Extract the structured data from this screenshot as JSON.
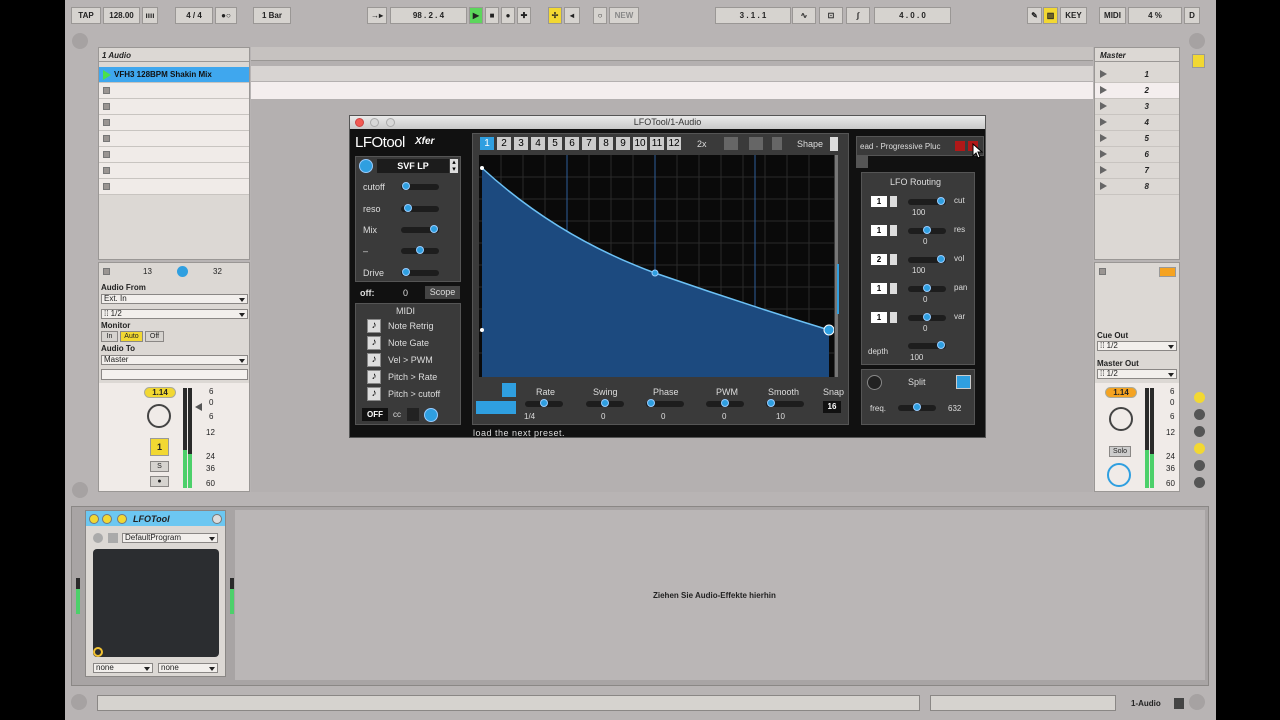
{
  "transport": {
    "tap": "TAP",
    "tempo": "128.00",
    "meter_glyph": "ıııı",
    "signature": "4 / 4",
    "metronome": "●○",
    "quantize": "1 Bar",
    "follow": "→▸",
    "position": "98 .   2 .   4",
    "new": "NEW",
    "loop_start": "3 .   1 .   1",
    "loop_len": "4 .   0 .   0",
    "key": "KEY",
    "midi": "MIDI",
    "cpu": "4 %",
    "disk": "D"
  },
  "track": {
    "name": "1 Audio",
    "clip": "VFH3 128BPM Shakin Mix",
    "seq_a": "13",
    "seq_b": "32",
    "audio_from_label": "Audio From",
    "audio_from": "Ext. In",
    "channel": "⁞⁞ 1/2",
    "monitor_label": "Monitor",
    "monitor_in": "In",
    "monitor_auto": "Auto",
    "monitor_off": "Off",
    "audio_to_label": "Audio To",
    "audio_to": "Master",
    "vol_display": "1.14",
    "meter_scale": [
      "6",
      "0",
      "6",
      "12",
      "24",
      "36",
      "60"
    ],
    "track_num": "1",
    "solo": "S",
    "arm": "●"
  },
  "master": {
    "name": "Master",
    "scenes": [
      "1",
      "2",
      "3",
      "4",
      "5",
      "6",
      "7",
      "8"
    ],
    "cue_out_label": "Cue Out",
    "cue_out": "⁞⁞ 1/2",
    "master_out_label": "Master Out",
    "master_out": "⁞⁞ 1/2",
    "vol_display": "1.14",
    "solo": "Solo",
    "meter_scale": [
      "6",
      "0",
      "6",
      "12",
      "24",
      "36",
      "60"
    ]
  },
  "device": {
    "name": "LFOTool",
    "program": "DefaultProgram",
    "sel_a": "none",
    "sel_b": "none",
    "drop_hint": "Ziehen Sie Audio-Effekte hierhin",
    "track_label": "1-Audio"
  },
  "plugin": {
    "window_title": "LFOTool/1-Audio",
    "logo": "LFOtool",
    "brand": "Xfer",
    "filter_type": "SVF LP",
    "params": [
      "cutoff",
      "reso",
      "Mix",
      "–",
      "Drive"
    ],
    "offset_label": "off:",
    "offset_val": "0",
    "scope": "Scope",
    "midi_title": "MIDI",
    "midi_items": [
      "Note Retrig",
      "Note Gate",
      "Vel > PWM",
      "Pitch > Rate",
      "Pitch > cutoff"
    ],
    "off_btn": "OFF",
    "cc": "cc",
    "tabs": [
      "1",
      "2",
      "3",
      "4",
      "5",
      "6",
      "7",
      "8",
      "9",
      "10",
      "11",
      "12"
    ],
    "mult": "2x",
    "shape": "Shape",
    "knob_labels": [
      "Rate",
      "Swing",
      "Phase",
      "PWM",
      "Smooth",
      "Snap"
    ],
    "knob_values": [
      "1/4",
      "0",
      "0",
      "0",
      "10",
      "16"
    ],
    "status": "load the next preset.",
    "preset": "ead - Progressive Pluc",
    "routing_title": "LFO Routing",
    "routing": [
      {
        "num": "1",
        "target": "cut",
        "amount": "100"
      },
      {
        "num": "1",
        "target": "res",
        "amount": "0"
      },
      {
        "num": "2",
        "target": "vol",
        "amount": "100"
      },
      {
        "num": "1",
        "target": "pan",
        "amount": "0"
      },
      {
        "num": "1",
        "target": "var",
        "amount": "0"
      }
    ],
    "depth_label": "depth",
    "depth_val": "100",
    "split": "Split",
    "freq_label": "freq.",
    "freq_val": "632",
    "colors": {
      "accent": "#2f9fe0",
      "panel": "#3a3a3a"
    }
  }
}
